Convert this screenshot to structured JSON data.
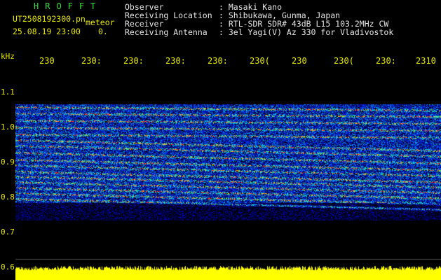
{
  "logo": "HROFFT",
  "file": {
    "name": "UT2508192300.pn",
    "kind": "meteor",
    "datetime": "25.08.19 23:00",
    "counter": "0."
  },
  "info": {
    "rows": [
      {
        "label": "Observer",
        "value": ": Masaki Kano"
      },
      {
        "label": "Receiving Location",
        "value": ": Shibukawa, Gunma, Japan"
      },
      {
        "label": "Receiver",
        "value": ": RTL-SDR SDR# 43dB L15 103.2MHz CW"
      },
      {
        "label": "Receiving Antenna",
        "value": ": 3el Yagi(V) Az 330 for Vladivostok"
      }
    ]
  },
  "axis": {
    "unit": "kHz",
    "time_labels": [
      "230",
      "230:",
      "230:",
      "230:",
      "230:",
      "230(",
      "230",
      "230(",
      "230:",
      "2310"
    ],
    "freq_labels": [
      "1.1",
      "1.0",
      "0.9",
      "0.8",
      "0.7",
      "0.6"
    ]
  },
  "colors": {
    "background": "#000000",
    "text": "#e8e800",
    "info_text": "#e6e6e6",
    "logo": "#33dd33",
    "noise": "#0000aa",
    "signal_high": "#ff3030",
    "strip": "#ffff00"
  }
}
